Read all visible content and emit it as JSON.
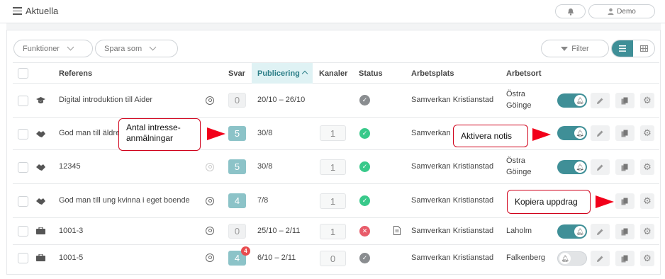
{
  "header": {
    "title": "Aktuella",
    "user_label": "Demo"
  },
  "toolbar": {
    "functions_label": "Funktioner",
    "save_as_label": "Spara som",
    "filter_label": "Filter"
  },
  "columns": [
    "Referens",
    "Svar",
    "Publicering",
    "Kanaler",
    "Status",
    "Arbetsplats",
    "Arbetsort"
  ],
  "rows": [
    {
      "reference": "Digital introduktion till Aider",
      "type_icon": "graduation-cap-icon",
      "answers": "0",
      "publishing": "20/10 – 26/10",
      "channels": "",
      "status": "grey-check",
      "workplace": "Samverkan Kristianstad",
      "location_line1": "Östra",
      "location_line2": "Göinge",
      "notify": "on"
    },
    {
      "reference": "God man till äldre",
      "type_icon": "handshake-icon",
      "answers": "5",
      "publishing": "30/8",
      "channels": "1",
      "status": "green-check",
      "workplace": "Samverkan Kristianstad",
      "location_line1": "",
      "location_line2": "",
      "notify": "on"
    },
    {
      "reference": "12345",
      "type_icon": "handshake-icon",
      "answers": "5",
      "publishing": "30/8",
      "channels": "1",
      "status": "green-check",
      "workplace": "Samverkan Kristianstad",
      "location_line1": "Östra",
      "location_line2": "Göinge",
      "notify": "on"
    },
    {
      "reference": "God man till ung kvinna i eget boende",
      "type_icon": "handshake-icon",
      "answers": "4",
      "publishing": "7/8",
      "channels": "1",
      "status": "green-check",
      "workplace": "Samverkan Kristianstad",
      "location_line1": "",
      "location_line2": "",
      "notify": "on"
    },
    {
      "reference": "1001-3",
      "type_icon": "briefcase-icon",
      "answers": "0",
      "publishing": "25/10 – 2/11",
      "channels": "1",
      "status": "red-x",
      "workplace": "Samverkan Kristianstad",
      "location_line1": "Laholm",
      "location_line2": "",
      "notify": "on"
    },
    {
      "reference": "1001-5",
      "type_icon": "briefcase-icon",
      "answers": "4",
      "answers_badge": "4",
      "publishing": "6/10 – 2/11",
      "channels": "0",
      "status": "grey-check",
      "workplace": "Samverkan Kristianstad",
      "location_line1": "Falkenberg",
      "location_line2": "",
      "notify": "off"
    }
  ],
  "annotations": {
    "interest_line1": "Antal intresse-",
    "interest_line2": "anmälningar",
    "notify": "Aktivera notis",
    "copy": "Kopiera uppdrag"
  },
  "colors": {
    "accent": "#3f8f97",
    "callout_border": "#d0021b",
    "arrow": "#f2001a",
    "success": "#38c98a",
    "error": "#e85c6a"
  }
}
